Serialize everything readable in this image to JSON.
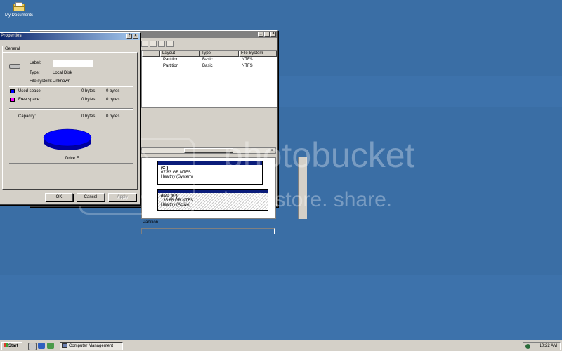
{
  "desktop": {
    "icon_label": "My Documents"
  },
  "computer_management": {
    "columns": [
      "Layout",
      "Type",
      "File System"
    ],
    "rows": [
      {
        "layout": "Partition",
        "type": "Basic",
        "fs": "NTFS"
      },
      {
        "layout": "Partition",
        "type": "Basic",
        "fs": "NTFS"
      }
    ],
    "partitions": [
      {
        "name": "(C:)",
        "size": "67.83 GB NTFS",
        "status": "Healthy (System)"
      },
      {
        "name": "data  (F:)",
        "size": "135.66 GB NTFS",
        "status": "Healthy (Active)"
      }
    ],
    "status_text": "Partition"
  },
  "properties": {
    "title": "Properties",
    "tab": "General",
    "label_caption": "Label:",
    "label_value": "",
    "type_caption": "Type:",
    "type_value": "Local Disk",
    "fs_caption": "File system:",
    "fs_value": "Unknown",
    "used_caption": "Used space:",
    "used_bytes": "0 bytes",
    "used_gb": "0 bytes",
    "free_caption": "Free space:",
    "free_bytes": "0 bytes",
    "free_gb": "0 bytes",
    "capacity_caption": "Capacity:",
    "capacity_bytes": "0 bytes",
    "capacity_gb": "0 bytes",
    "drive_caption": "Drive F",
    "ok": "OK",
    "cancel": "Cancel",
    "apply": "Apply",
    "help": "?",
    "close": "×",
    "colors": {
      "used": "#0000ff",
      "free": "#ff00ff"
    }
  },
  "watermark": {
    "line1": "photobucket",
    "line2": "host. store. share."
  },
  "taskbar": {
    "start": "Start",
    "task": "Computer Management",
    "clock": "10:22 AM"
  }
}
